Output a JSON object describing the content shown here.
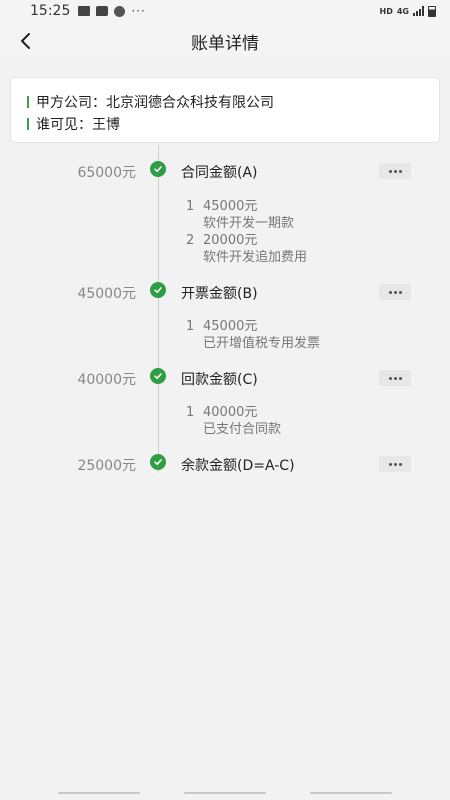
{
  "status_bar": {
    "time": "15:25",
    "icons": [
      "image-icon",
      "message-icon",
      "swirl-icon"
    ],
    "more": "···",
    "hd": "HD",
    "network": "4G"
  },
  "nav": {
    "title": "账单详情",
    "back_icon": "chevron-left-icon"
  },
  "info": {
    "company": "甲方公司：北京润德合众科技有限公司",
    "visible_to": "谁可见：王博"
  },
  "colors": {
    "accent": "#2e9e45",
    "background": "#f2f2f2"
  },
  "timeline": [
    {
      "amount": "65000元",
      "label": "合同金额(A)",
      "details": [
        {
          "index": "1",
          "value": "45000元",
          "desc": "软件开发一期款"
        },
        {
          "index": "2",
          "value": "20000元",
          "desc": "软件开发追加费用"
        }
      ]
    },
    {
      "amount": "45000元",
      "label": "开票金额(B)",
      "details": [
        {
          "index": "1",
          "value": "45000元",
          "desc": "已开增值税专用发票"
        }
      ]
    },
    {
      "amount": "40000元",
      "label": "回款金额(C)",
      "details": [
        {
          "index": "1",
          "value": "40000元",
          "desc": "已支付合同款"
        }
      ]
    },
    {
      "amount": "25000元",
      "label": "余款金额(D=A-C)",
      "details": []
    }
  ]
}
